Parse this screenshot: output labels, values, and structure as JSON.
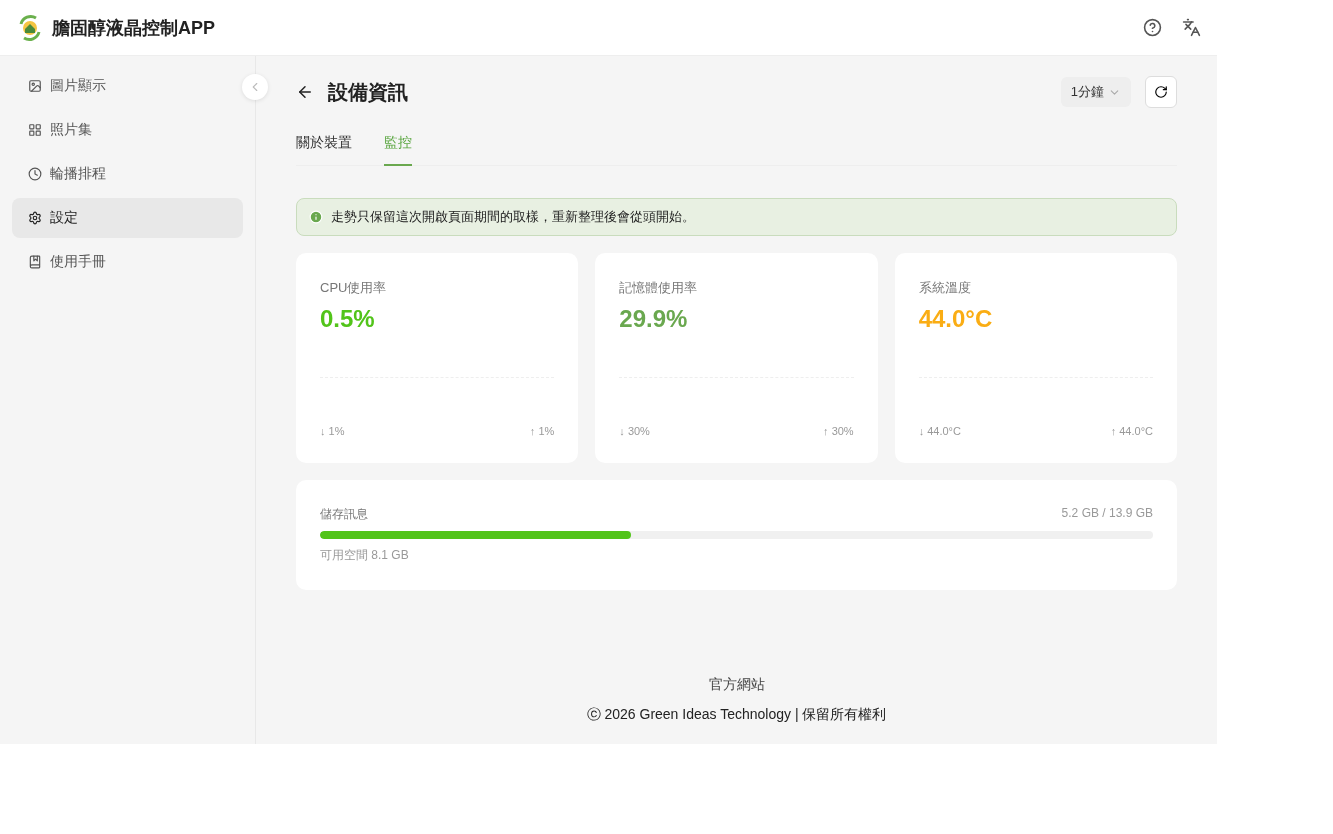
{
  "header": {
    "title": "膽固醇液晶控制APP"
  },
  "sidebar": {
    "items": [
      {
        "label": "圖片顯示",
        "kind": "image",
        "selected": false
      },
      {
        "label": "照片集",
        "kind": "grid",
        "selected": false
      },
      {
        "label": "輪播排程",
        "kind": "clock",
        "selected": false
      },
      {
        "label": "設定",
        "kind": "gear",
        "selected": true
      },
      {
        "label": "使用手冊",
        "kind": "book",
        "selected": false
      }
    ]
  },
  "page": {
    "title": "設備資訊",
    "interval": "1分鐘"
  },
  "tabs": [
    {
      "label": "關於裝置",
      "selected": false
    },
    {
      "label": "監控",
      "selected": true
    }
  ],
  "notice": "走勢只保留這次開啟頁面期間的取樣，重新整理後會從頭開始。",
  "metrics": [
    {
      "label": "CPU使用率",
      "value": "0.5%",
      "color": "#52c41a",
      "min": "↓ 1%",
      "max": "↑ 1%"
    },
    {
      "label": "記憶體使用率",
      "value": "29.9%",
      "color": "#6aa84f",
      "min": "↓ 30%",
      "max": "↑ 30%"
    },
    {
      "label": "系統溫度",
      "value": "44.0°C",
      "color": "#faad14",
      "min": "↓ 44.0°C",
      "max": "↑ 44.0°C"
    }
  ],
  "storage": {
    "label": "儲存訊息",
    "usage": "5.2 GB / 13.9 GB",
    "level": 0.373,
    "free": "可用空間 8.1 GB"
  },
  "footer": {
    "link": "官方網站",
    "copyright": "ⓒ 2026 Green Ideas Technology | 保留所有權利"
  }
}
